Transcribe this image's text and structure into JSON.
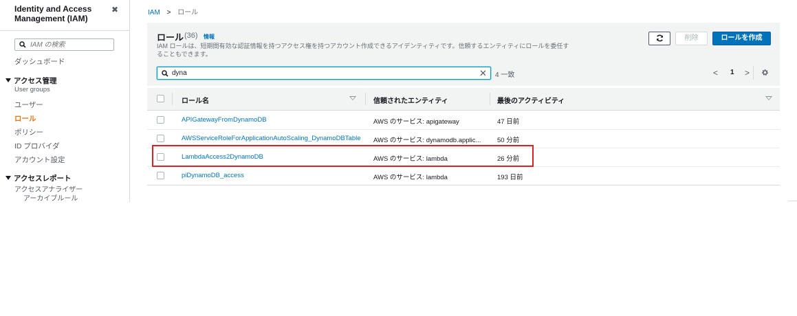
{
  "sidebar": {
    "title": "Identity and Access Management (IAM)",
    "search_placeholder": "IAM の検索",
    "dashboard": "ダッシュボード",
    "access_management": {
      "label": "アクセス管理",
      "items": [
        "User groups",
        "ユーザー",
        "ロール",
        "ポリシー",
        "ID プロバイダ",
        "アカウント設定"
      ],
      "active": "ロール"
    },
    "access_reports": {
      "label": "アクセスレポート",
      "items": [
        "アクセスアナライザー",
        "アーカイブルール"
      ]
    }
  },
  "breadcrumb": {
    "root": "IAM",
    "current": "ロール"
  },
  "main": {
    "title": "ロール",
    "count": "(36)",
    "info": "情報",
    "description": "IAM ロールは、短期間有効な認証情報を持つアクセス権を持つアカウント作成できるアイデンティティです。信頼するエンティティにロールを委任することもできます。",
    "buttons": {
      "delete": "削除",
      "create": "ロールを作成"
    },
    "filter": {
      "value": "dyna",
      "match": "4 一致"
    },
    "pagination": {
      "page": "1"
    },
    "table": {
      "columns": [
        "ロール名",
        "信頼されたエンティティ",
        "最後のアクティビティ"
      ],
      "rows": [
        {
          "name": "APIGatewayFromDynamoDB",
          "entity": "AWS のサービス: apigateway",
          "activity": "47 日前"
        },
        {
          "name": "AWSServiceRoleForApplicationAutoScaling_DynamoDBTable",
          "entity": "AWS のサービス: dynamodb.applic...",
          "activity": "50 分前"
        },
        {
          "name": "LambdaAccess2DynamoDB",
          "entity": "AWS のサービス: lambda",
          "activity": "26 分前"
        },
        {
          "name": "piDynamoDB_access",
          "entity": "AWS のサービス: lambda",
          "activity": "193 日前"
        }
      ]
    }
  },
  "colors": {
    "link": "#0073bb",
    "primary": "#0073bb",
    "active_nav": "#ec7211",
    "highlight": "#e02020"
  }
}
